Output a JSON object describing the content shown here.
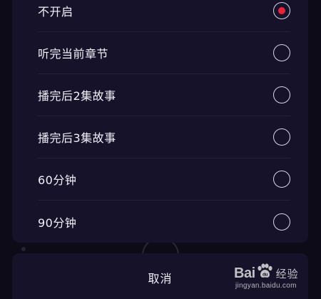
{
  "options": [
    {
      "label": "不开启",
      "selected": true
    },
    {
      "label": "听完当前章节",
      "selected": false
    },
    {
      "label": "播完后2集故事",
      "selected": false
    },
    {
      "label": "播完后3集故事",
      "selected": false
    },
    {
      "label": "60分钟",
      "selected": false
    },
    {
      "label": "90分钟",
      "selected": false
    }
  ],
  "cancel_label": "取消",
  "watermark": {
    "brand_left": "Bai",
    "brand_right": "经验",
    "url": "jingyan.baidu.com"
  },
  "colors": {
    "sheet_bg": "#15122a",
    "page_bg": "#0d0b17",
    "accent": "#e8243c",
    "text": "#f2f1f7"
  }
}
